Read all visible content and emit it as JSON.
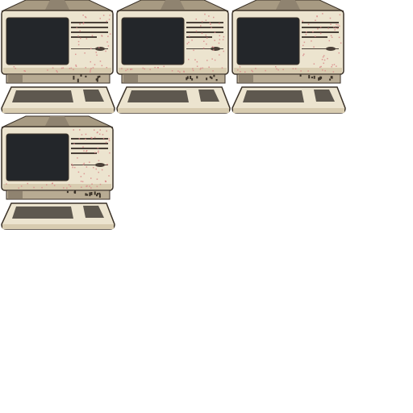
{
  "sprite_sheet": {
    "asset": "retro-computer-terminal",
    "frame_count": 4,
    "columns": 3,
    "frames": [
      {
        "id": 1,
        "grime_level": 1
      },
      {
        "id": 2,
        "grime_level": 2
      },
      {
        "id": 3,
        "grime_level": 2
      },
      {
        "id": 4,
        "grime_level": 3
      }
    ],
    "colors": {
      "background": "#ffffff",
      "outline": "#3b3228",
      "casing": "#ece4cf",
      "casing_shade": "#d8ccb0",
      "hood": "#a79a82",
      "hood_shade": "#8f8370",
      "screen": "#23262a",
      "vent_line": "#4a4038",
      "base": "#b8ab93",
      "keys": "#5e584f",
      "dirt": "#d98a8a"
    }
  }
}
